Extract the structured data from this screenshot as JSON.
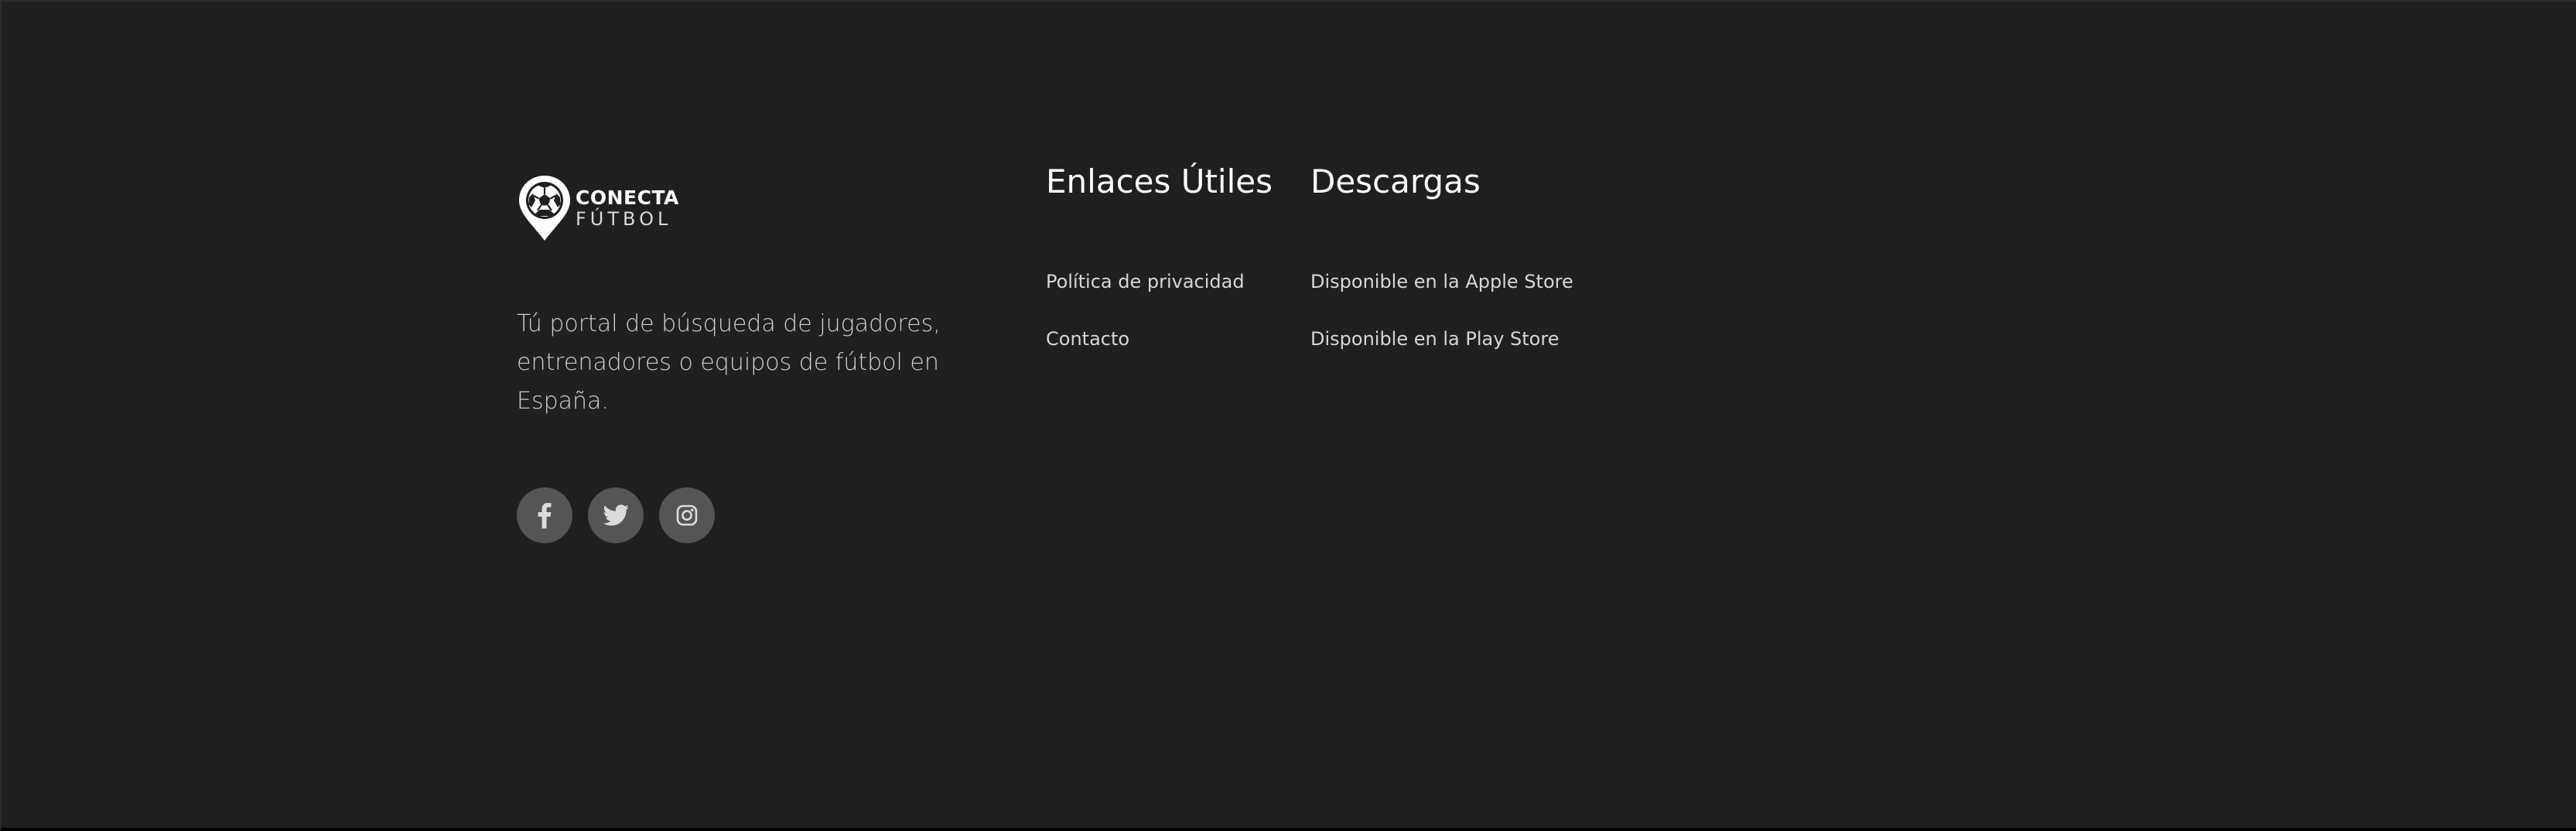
{
  "brand": {
    "logo_line1": "CONECTA",
    "logo_line2": "FÚTBOL",
    "tagline": "Tú portal de búsqueda de jugadores, entrenadores o equipos de fútbol en España."
  },
  "social": [
    {
      "network": "facebook",
      "icon": "facebook-icon"
    },
    {
      "network": "twitter",
      "icon": "twitter-icon"
    },
    {
      "network": "instagram",
      "icon": "instagram-icon"
    }
  ],
  "links": {
    "title": "Enlaces Útiles",
    "items": [
      {
        "label": "Política de privacidad"
      },
      {
        "label": "Contacto"
      }
    ]
  },
  "downloads": {
    "title": "Descargas",
    "items": [
      {
        "label": "Disponible en la Apple Store"
      },
      {
        "label": "Disponible en la Play Store"
      }
    ]
  },
  "colors": {
    "background": "#1f1f1f",
    "social_bg": "#555555",
    "text_primary": "#ffffff",
    "text_secondary": "#d6d6d6"
  }
}
